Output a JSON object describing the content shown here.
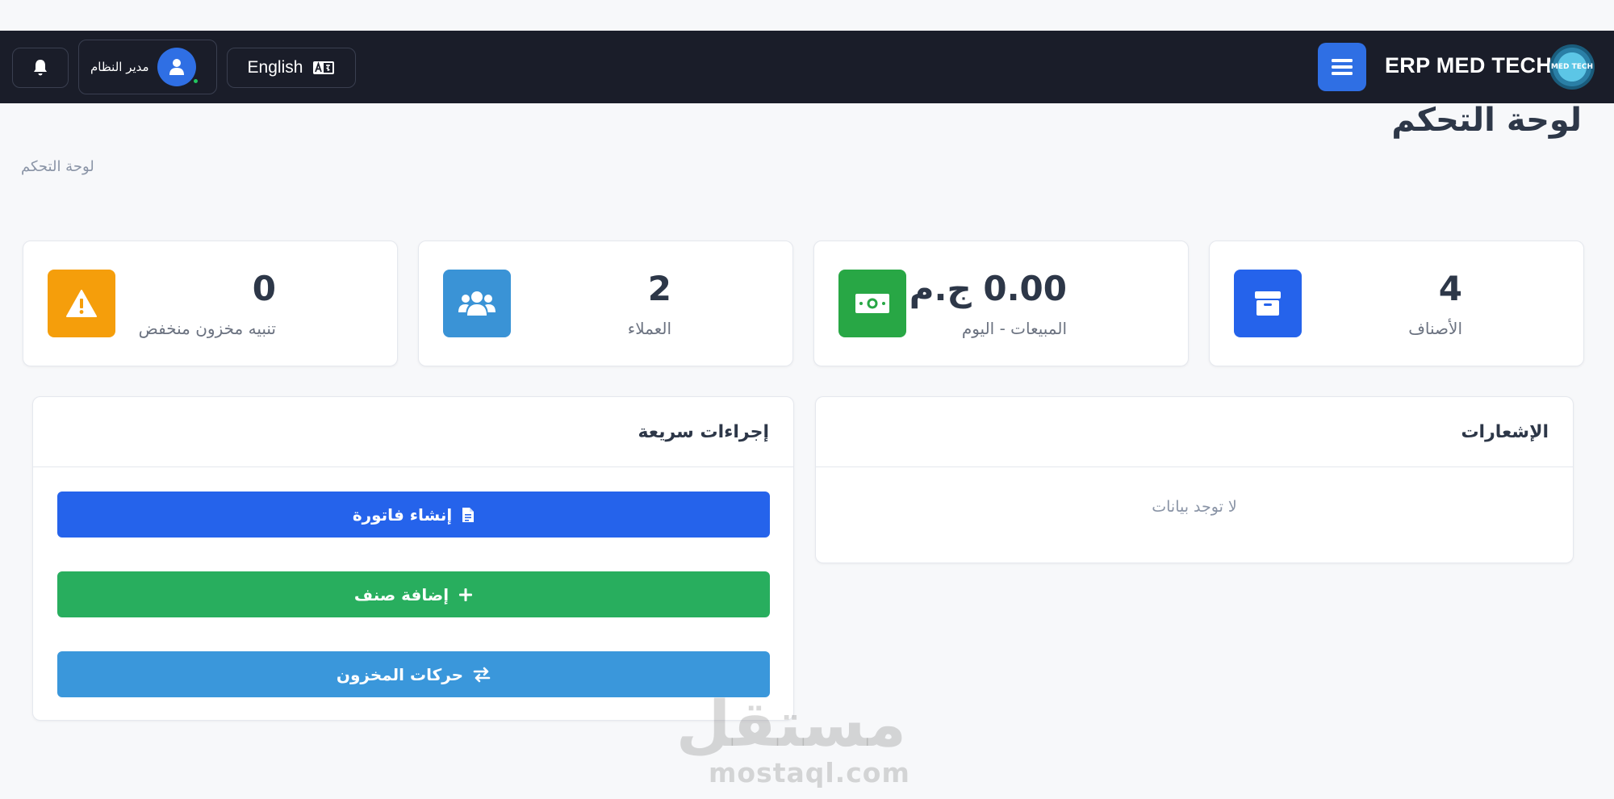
{
  "header": {
    "brand": "ERP MED TECH",
    "brand_logo_text": "MED TECH",
    "language_label": "English",
    "user_name": "مدير النظام"
  },
  "page": {
    "title": "لوحة التحكم",
    "breadcrumb": "لوحة التحكم"
  },
  "stats": [
    {
      "value": "4",
      "label": "الأصناف",
      "color": "#2563eb",
      "icon": "box-icon"
    },
    {
      "value": "0.00 ج.م",
      "label": "المبيعات - اليوم",
      "color": "#28a745",
      "icon": "money-bill-icon"
    },
    {
      "value": "2",
      "label": "العملاء",
      "color": "#3a93d6",
      "icon": "users-icon"
    },
    {
      "value": "0",
      "label": "تنبيه مخزون منخفض",
      "color": "#f59e0b",
      "icon": "warning-icon"
    }
  ],
  "notifications": {
    "title": "الإشعارات",
    "empty_text": "لا توجد بيانات"
  },
  "quick_actions": {
    "title": "إجراءات سريعة",
    "create_invoice": "إنشاء فاتورة",
    "add_item": "إضافة صنف",
    "stock_movements": "حركات المخزون"
  },
  "colors": {
    "navbar": "#1a1d29",
    "primary": "#2563eb",
    "success": "#28a745",
    "info": "#3a93d6",
    "warning": "#f59e0b"
  },
  "watermark": {
    "arabic": "مستقل",
    "latin": "mostaql.com"
  }
}
